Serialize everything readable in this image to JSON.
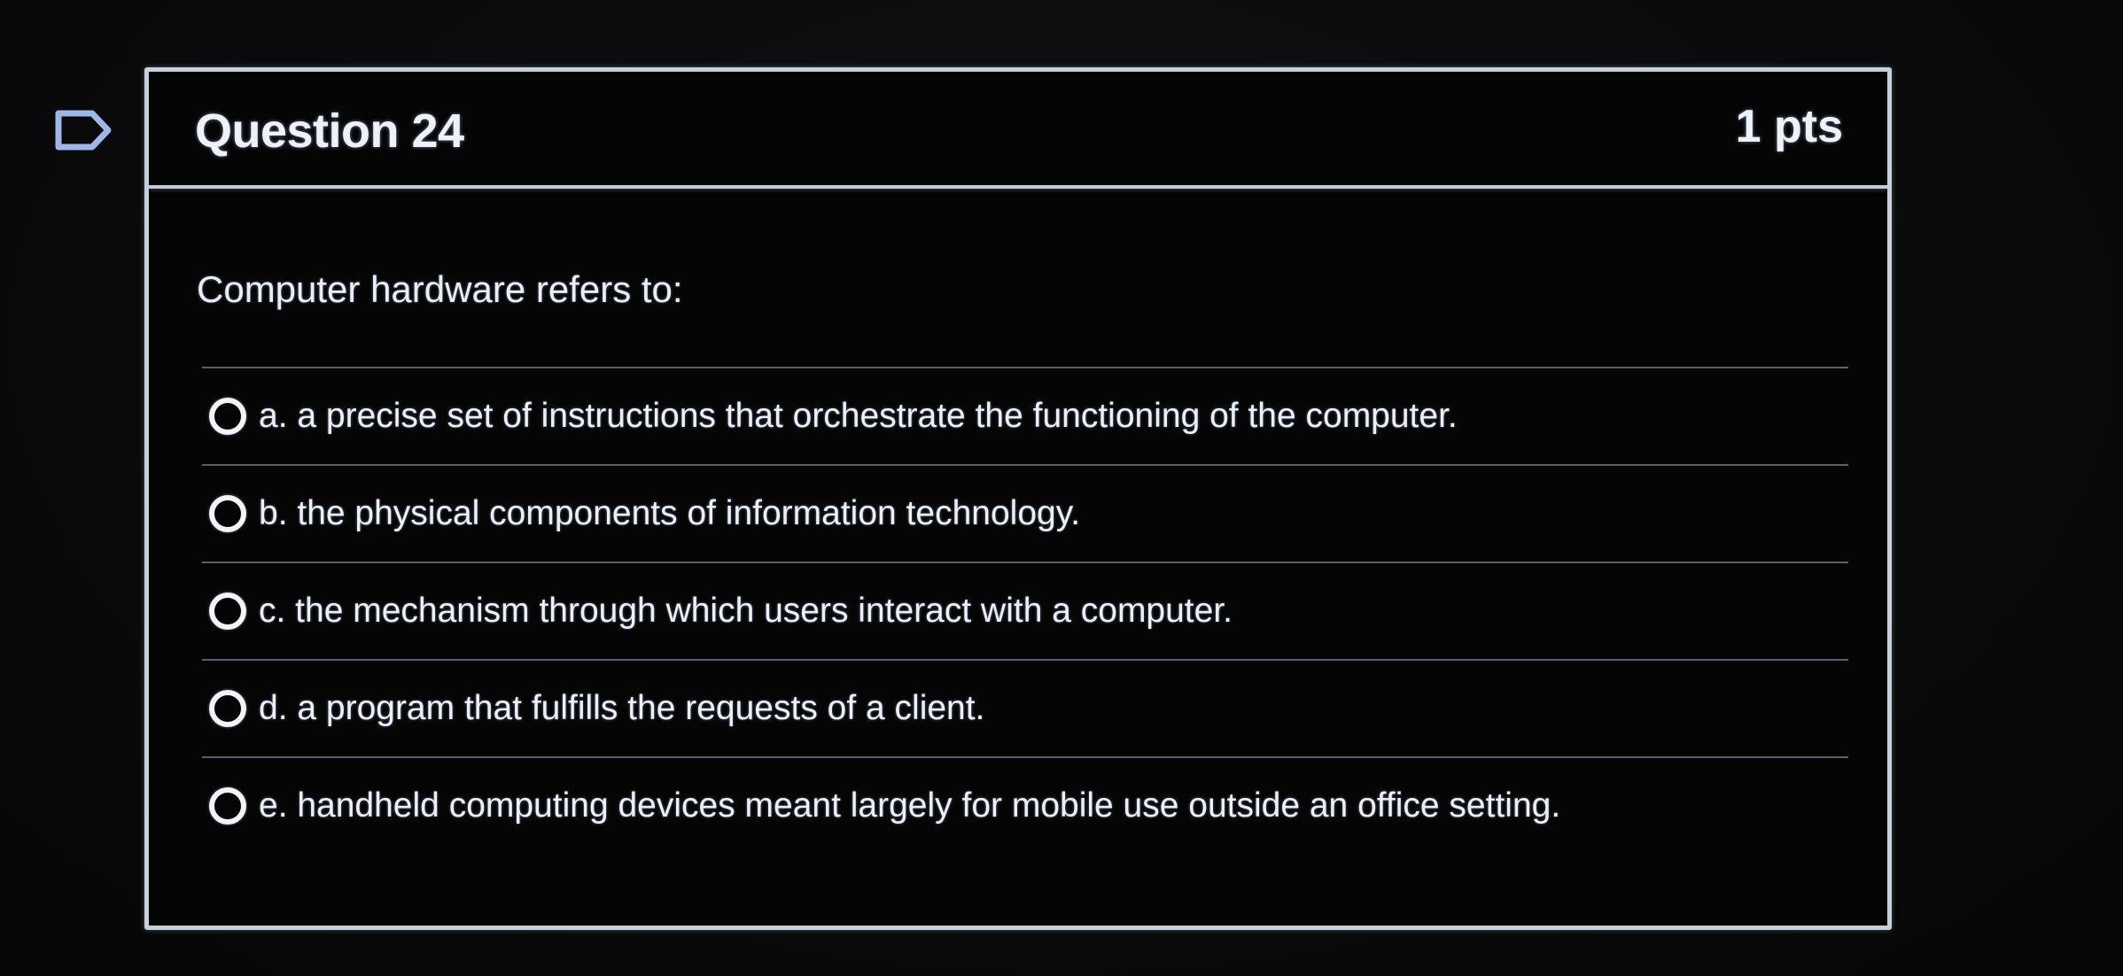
{
  "question": {
    "title": "Question 24",
    "points": "1 pts",
    "text": "Computer hardware refers to:",
    "flag_icon": "flag-icon"
  },
  "answers": [
    {
      "label": "a. a precise set of instructions that orchestrate the functioning of the computer."
    },
    {
      "label": "b. the physical components of information technology."
    },
    {
      "label": "c. the mechanism through which users interact with a computer."
    },
    {
      "label": "d. a program that fulfills the requests of a client."
    },
    {
      "label": "e. handheld computing devices meant largely for mobile use outside an office setting."
    }
  ]
}
